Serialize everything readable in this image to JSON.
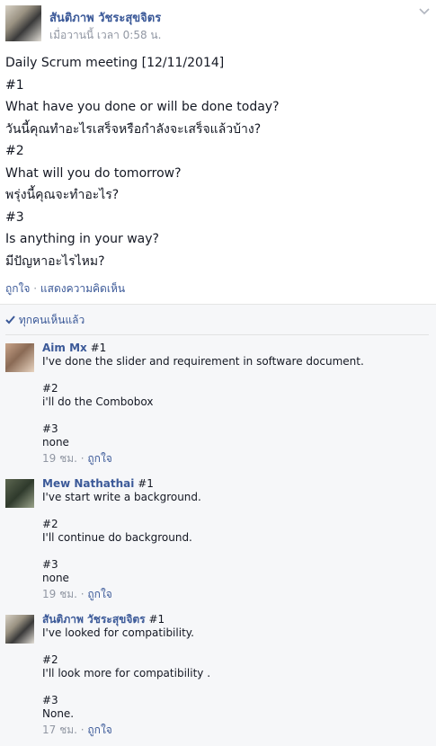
{
  "post": {
    "author": "สันติภาพ วัชระสุขจิตร",
    "timestamp": "เมื่อวานนี้ เวลา 0:58 น.",
    "lines": [
      "Daily Scrum meeting [12/11/2014]",
      "#1",
      "What have you done or will be done today?",
      "วันนี้คุณทำอะไรเสร็จหรือกำลังจะเสร็จแล้วบ้าง?",
      "#2",
      "What will you do tomorrow?",
      "พรุ่งนี้คุณจะทำอะไร?",
      "#3",
      "Is anything in your way?",
      "มีปัญหาอะไรไหม?"
    ],
    "like": "ถูกใจ",
    "separator": "·",
    "comment": "แสดงความคิดเห็น"
  },
  "seen_by": "ทุกคนเห็นแล้ว",
  "comments": [
    {
      "name": "Aim Mx",
      "first": "#1",
      "lines": [
        "I've done the slider and requirement in software document.",
        "",
        "#2",
        "i'll do the Combobox",
        "",
        "#3",
        "none"
      ],
      "time": "19 ชม.",
      "like": "ถูกใจ"
    },
    {
      "name": "Mew Nathathai",
      "first": "#1",
      "lines": [
        "I've start write a background.",
        "",
        "#2",
        "I'll continue do background.",
        "",
        "#3",
        "none"
      ],
      "time": "19 ชม.",
      "like": "ถูกใจ"
    },
    {
      "name": "สันติภาพ วัชระสุขจิตร",
      "first": "#1",
      "lines": [
        "I've looked for compatibility.",
        "",
        "#2",
        "I'll look more for compatibility .",
        "",
        "#3",
        "None."
      ],
      "time": "17 ชม.",
      "like": "ถูกใจ"
    }
  ]
}
